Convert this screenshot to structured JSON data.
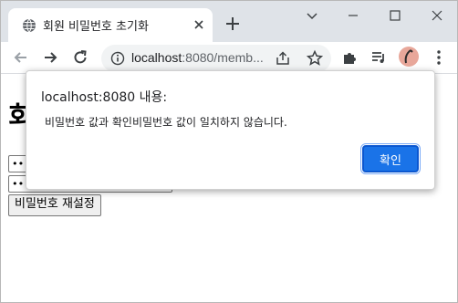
{
  "browser": {
    "tab": {
      "title": "회원 비밀번호 초기화",
      "favicon": "globe-icon"
    },
    "window_controls": [
      "minimize-icon",
      "maximize-icon",
      "close-icon"
    ],
    "address_bar": {
      "host": "localhost",
      "rest": ":8080/memb..."
    },
    "colors": {
      "tabstrip": "#dfe3e8",
      "accent": "#1a73e8",
      "avatar": "#e8a79a"
    }
  },
  "page": {
    "heading": "회",
    "password_value": "•••",
    "password_confirm_value": "•••",
    "reset_button_label": "비밀번호 재설정"
  },
  "dialog": {
    "title": "localhost:8080 내용:",
    "message": "비밀번호 값과 확인비밀번호 값이 일치하지 않습니다.",
    "ok_label": "확인"
  }
}
